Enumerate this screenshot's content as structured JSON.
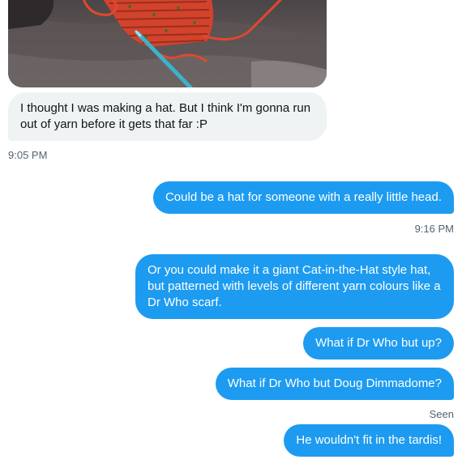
{
  "conversation": {
    "received": {
      "message": "I thought I was making a hat. But I think I'm gonna run out of yarn before it gets that far :P",
      "time": "9:05 PM"
    },
    "sent": [
      {
        "text": "Could be a hat for someone with a really little head.",
        "time": "9:16 PM"
      },
      {
        "text": "Or you could make it a giant Cat-in-the-Hat style hat, but patterned with levels of different yarn colours like a Dr Who scarf."
      },
      {
        "text": "What if Dr Who but up?"
      },
      {
        "text": "What if Dr Who but Doug Dimmadome?",
        "status": "Seen"
      },
      {
        "text": "He wouldn't fit in the tardis!"
      }
    ]
  },
  "colors": {
    "sent_bubble": "#1d9bf0",
    "received_bubble": "#eff3f4",
    "meta_text": "#536471"
  }
}
